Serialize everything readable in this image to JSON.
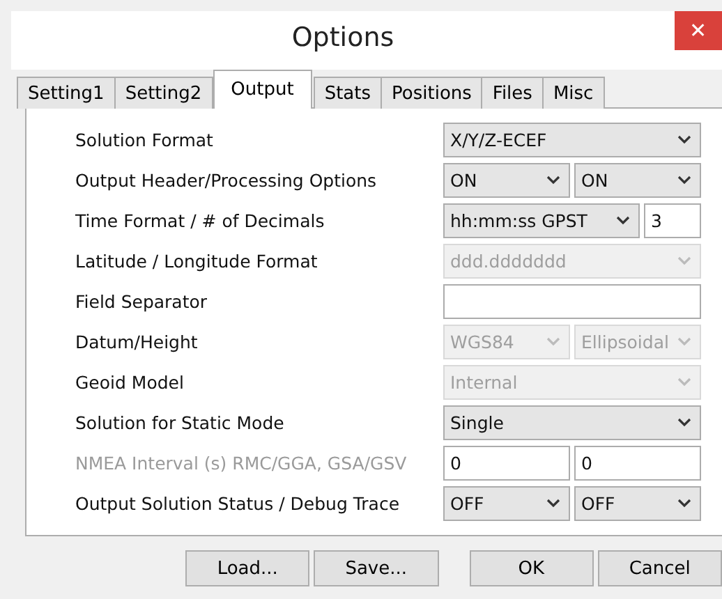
{
  "window": {
    "title": "Options",
    "close": "✕"
  },
  "tabs": [
    {
      "label": "Setting1",
      "selected": false
    },
    {
      "label": "Setting2",
      "selected": false
    },
    {
      "label": "Output",
      "selected": true
    },
    {
      "label": "Stats",
      "selected": false
    },
    {
      "label": "Positions",
      "selected": false
    },
    {
      "label": "Files",
      "selected": false
    },
    {
      "label": "Misc",
      "selected": false
    }
  ],
  "rows": [
    {
      "label": "Solution Format",
      "disabled": false,
      "controls": [
        {
          "kind": "select",
          "value": "X/Y/Z-ECEF",
          "disabled": false
        }
      ]
    },
    {
      "label": "Output Header/Processing Options",
      "disabled": false,
      "controls": [
        {
          "kind": "select",
          "value": "ON",
          "disabled": false
        },
        {
          "kind": "select",
          "value": "ON",
          "disabled": false
        }
      ]
    },
    {
      "label": "Time Format / # of Decimals",
      "disabled": false,
      "controls": [
        {
          "kind": "select",
          "value": "hh:mm:ss GPST",
          "disabled": false
        },
        {
          "kind": "input",
          "value": "3",
          "disabled": false
        }
      ]
    },
    {
      "label": "Latitude / Longitude Format",
      "disabled": false,
      "controls": [
        {
          "kind": "select",
          "value": "ddd.ddddddd",
          "disabled": true
        }
      ]
    },
    {
      "label": "Field Separator",
      "disabled": false,
      "controls": [
        {
          "kind": "input",
          "disabled": false
        }
      ]
    },
    {
      "label": "Datum/Height",
      "disabled": false,
      "controls": [
        {
          "kind": "select",
          "value": "WGS84",
          "disabled": true
        },
        {
          "kind": "select",
          "value": "Ellipsoidal",
          "disabled": true
        }
      ]
    },
    {
      "label": "Geoid Model",
      "disabled": false,
      "controls": [
        {
          "kind": "select",
          "value": "Internal",
          "disabled": true
        }
      ]
    },
    {
      "label": "Solution for Static Mode",
      "disabled": false,
      "controls": [
        {
          "kind": "select",
          "value": "Single",
          "disabled": false
        }
      ]
    },
    {
      "label": "NMEA Interval (s) RMC/GGA, GSA/GSV",
      "disabled": true,
      "controls": [
        {
          "kind": "input",
          "value": "0",
          "disabled": false
        },
        {
          "kind": "input",
          "value": "0",
          "disabled": false
        }
      ]
    },
    {
      "label": "Output Solution Status / Debug Trace",
      "disabled": false,
      "controls": [
        {
          "kind": "select",
          "value": "OFF",
          "disabled": false
        },
        {
          "kind": "select",
          "value": "OFF",
          "disabled": false
        }
      ]
    }
  ],
  "buttons": [
    "Load...",
    "Save...",
    "OK",
    "Cancel"
  ]
}
